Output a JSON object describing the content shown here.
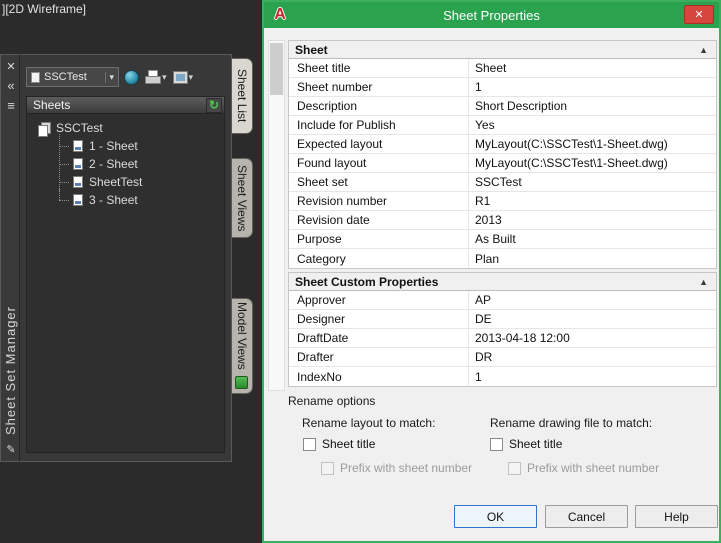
{
  "viewport": {
    "label": "][2D Wireframe]"
  },
  "icons": {
    "close": "✕",
    "dropdown": "▾",
    "collapse": "▲",
    "refresh": "↻",
    "autohide": "«",
    "properties": "≡",
    "pencil": "✎"
  },
  "palette": {
    "title": "Sheet Set Manager",
    "combo_value": "SSCTest",
    "sheets_header": "Sheets",
    "tree": {
      "root": "SSCTest",
      "items": [
        "1 - Sheet",
        "2 - Sheet",
        "SheetTest",
        "3 - Sheet"
      ]
    },
    "tabs": [
      "Sheet List",
      "Sheet Views",
      "Model Views"
    ]
  },
  "dialog": {
    "title": "Sheet Properties",
    "logo": "A",
    "sections": [
      {
        "header": "Sheet",
        "rows": [
          {
            "label": "Sheet title",
            "value": "Sheet"
          },
          {
            "label": "Sheet number",
            "value": "1"
          },
          {
            "label": "Description",
            "value": "Short Description"
          },
          {
            "label": "Include for Publish",
            "value": "Yes"
          },
          {
            "label": "Expected layout",
            "value": "MyLayout(C:\\SSCTest\\1-Sheet.dwg)"
          },
          {
            "label": "Found layout",
            "value": "MyLayout(C:\\SSCTest\\1-Sheet.dwg)"
          },
          {
            "label": "Sheet set",
            "value": "SSCTest"
          },
          {
            "label": "Revision number",
            "value": "R1"
          },
          {
            "label": "Revision date",
            "value": "2013"
          },
          {
            "label": "Purpose",
            "value": "As Built"
          },
          {
            "label": "Category",
            "value": "Plan"
          }
        ]
      },
      {
        "header": "Sheet Custom Properties",
        "rows": [
          {
            "label": "Approver",
            "value": "AP"
          },
          {
            "label": "Designer",
            "value": "DE"
          },
          {
            "label": "DraftDate",
            "value": "2013-04-18 12:00"
          },
          {
            "label": "Drafter",
            "value": "DR"
          },
          {
            "label": "IndexNo",
            "value": "1"
          }
        ]
      }
    ],
    "rename": {
      "group_label": "Rename options",
      "col1_heading": "Rename layout to match:",
      "col2_heading": "Rename drawing file to match:",
      "sheet_title_label": "Sheet title",
      "prefix_label": "Prefix with sheet number"
    },
    "buttons": {
      "ok": "OK",
      "cancel": "Cancel",
      "help": "Help"
    }
  }
}
